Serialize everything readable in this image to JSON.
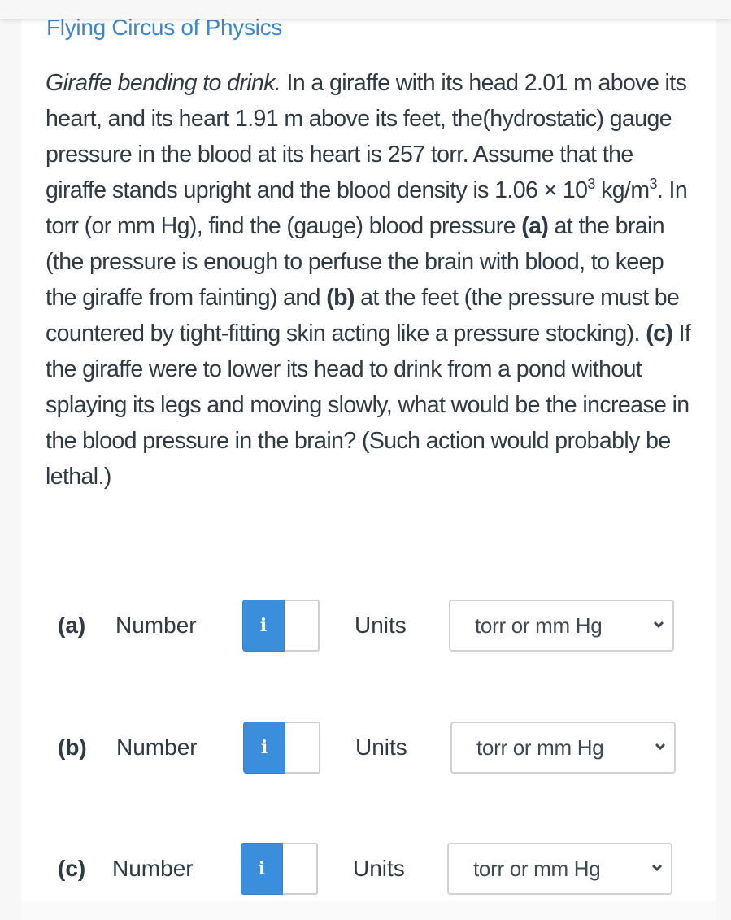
{
  "card": {
    "title": "Flying Circus of Physics"
  },
  "question": {
    "title_italic": "Giraffe bending to drink.",
    "text_1": " In a giraffe with its head 2.01 m above its heart, and its heart 1.91 m above its feet, the(hydrostatic) gauge pressure in the blood at its heart is 257 torr. Assume that the giraffe stands upright and the blood density is 1.06 × 10",
    "sup_1": "3",
    "text_2": " kg/m",
    "sup_2": "3",
    "text_3": ". In torr (or mm Hg), find the (gauge) blood pressure ",
    "part_a": "(a)",
    "text_4": " at the brain (the pressure is enough to perfuse the brain with blood, to keep the giraffe from fainting) and ",
    "part_b": "(b)",
    "text_5": " at the feet (the pressure must be countered by tight-fitting skin acting like a pressure stocking). ",
    "part_c": "(c)",
    "text_6": " If the giraffe were to lower its head to drink from a pond without splaying its legs and moving slowly, what would be the increase in the blood pressure in the brain? (Such action would probably be lethal.)"
  },
  "answers": [
    {
      "part": "(a)",
      "number_label": "Number",
      "info_icon": "i",
      "value": "",
      "units_label": "Units",
      "units_selected": "torr or mm Hg"
    },
    {
      "part": "(b)",
      "number_label": "Number",
      "info_icon": "i",
      "value": "",
      "units_label": "Units",
      "units_selected": "torr or mm Hg"
    },
    {
      "part": "(c)",
      "number_label": "Number",
      "info_icon": "i",
      "value": "",
      "units_label": "Units",
      "units_selected": "torr or mm Hg"
    }
  ],
  "colors": {
    "accent_blue": "#3b8edb",
    "title_blue": "#3a87d0",
    "text_dark": "#2f3a45"
  }
}
